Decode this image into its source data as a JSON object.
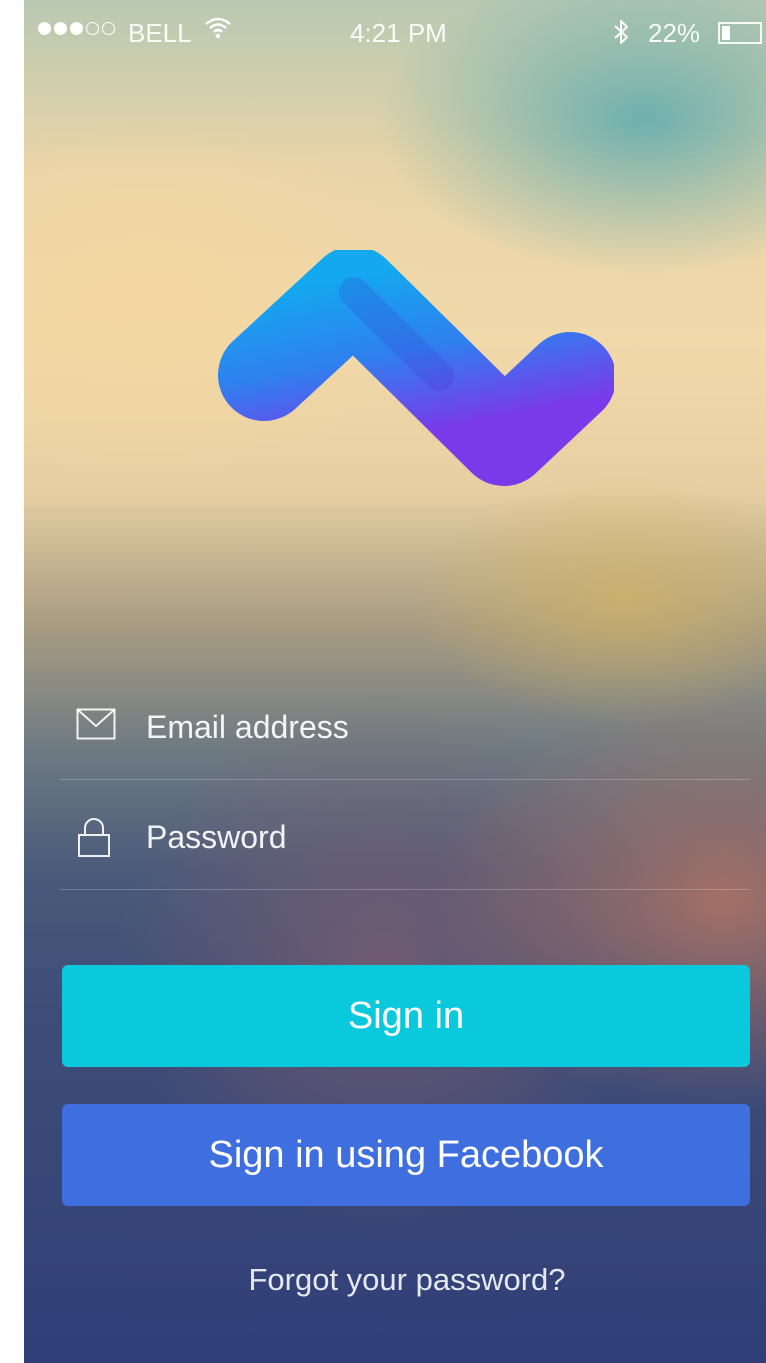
{
  "status_bar": {
    "carrier": "BELL",
    "time": "4:21 PM",
    "battery_percent_label": "22%",
    "battery_level": 0.22,
    "signal_bars_filled": 3,
    "signal_bars_total": 5,
    "icons": [
      "wifi-icon",
      "bluetooth-icon",
      "battery-icon"
    ]
  },
  "logo": {
    "name": "app-logo",
    "gradient_colors": [
      "#13a8ef",
      "#2f80ef",
      "#7a3aea"
    ]
  },
  "form": {
    "email": {
      "placeholder": "Email address",
      "value": "",
      "icon": "envelope-icon"
    },
    "password": {
      "placeholder": "Password",
      "value": "",
      "icon": "lock-icon"
    }
  },
  "buttons": {
    "signin": {
      "label": "Sign in",
      "color": "#0bc9dd"
    },
    "facebook": {
      "label": "Sign in using Facebook",
      "color": "#3f6ede"
    }
  },
  "forgot_link": "Forgot your password?"
}
